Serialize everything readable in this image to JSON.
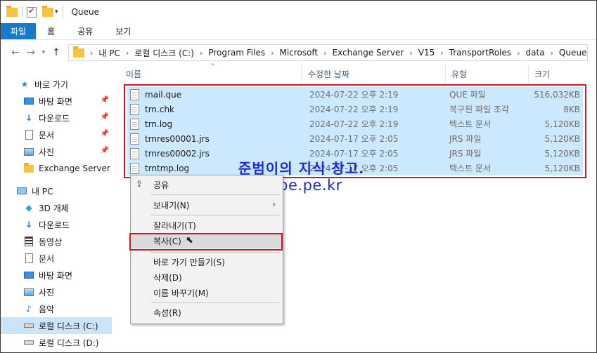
{
  "window": {
    "title": "Queue"
  },
  "ribbon": {
    "tabs": [
      "파일",
      "홈",
      "공유",
      "보기"
    ]
  },
  "address": {
    "crumbs": [
      "내 PC",
      "로컬 디스크 (C:)",
      "Program Files",
      "Microsoft",
      "Exchange Server",
      "V15",
      "TransportRoles",
      "data",
      "Queue"
    ]
  },
  "sidebar": {
    "items": [
      {
        "label": "바로 가기",
        "icon": "star-icon"
      },
      {
        "label": "바탕 화면",
        "icon": "desktop-icon"
      },
      {
        "label": "다운로드",
        "icon": "download-icon"
      },
      {
        "label": "문서",
        "icon": "document-icon"
      },
      {
        "label": "사진",
        "icon": "pictures-icon"
      },
      {
        "label": "Exchange Server",
        "icon": "folder-icon"
      },
      {
        "label": "내 PC",
        "icon": "pc-icon"
      },
      {
        "label": "3D 개체",
        "icon": "3d-objects-icon"
      },
      {
        "label": "다운로드",
        "icon": "download-icon"
      },
      {
        "label": "동영상",
        "icon": "video-icon"
      },
      {
        "label": "문서",
        "icon": "document-icon"
      },
      {
        "label": "바탕 화면",
        "icon": "desktop-icon"
      },
      {
        "label": "사진",
        "icon": "pictures-icon"
      },
      {
        "label": "음악",
        "icon": "music-icon"
      },
      {
        "label": "로컬 디스크 (C:)",
        "icon": "drive-icon"
      },
      {
        "label": "로컬 디스크 (D:)",
        "icon": "drive-icon"
      }
    ]
  },
  "columns": {
    "name": "이름",
    "date": "수정한 날짜",
    "type": "유형",
    "size": "크기"
  },
  "files": [
    {
      "name": "mail.que",
      "date": "2024-07-22 오후 2:19",
      "type": "QUE 파일",
      "size": "516,032KB"
    },
    {
      "name": "trn.chk",
      "date": "2024-07-22 오후 2:19",
      "type": "복구된 파일 조각",
      "size": "8KB"
    },
    {
      "name": "trn.log",
      "date": "2024-07-22 오후 2:19",
      "type": "텍스트 문서",
      "size": "5,120KB"
    },
    {
      "name": "trnres00001.jrs",
      "date": "2024-07-17 오후 2:05",
      "type": "JRS 파일",
      "size": "5,120KB"
    },
    {
      "name": "trnres00002.jrs",
      "date": "2024-07-17 오후 2:05",
      "type": "JRS 파일",
      "size": "5,120KB"
    },
    {
      "name": "trntmp.log",
      "date": "2024-07-17 오후 2:05",
      "type": "텍스트 문서",
      "size": "5,120KB"
    }
  ],
  "watermark": {
    "line1": "준범이의 지식 창고.",
    "line2": "hope.pe.kr"
  },
  "context_menu": {
    "share": "공유",
    "send_to": "보내기(N)",
    "cut": "잘라내기(T)",
    "copy": "복사(C)",
    "create_shortcut": "바로 가기 만들기(S)",
    "delete": "삭제(D)",
    "rename": "이름 바꾸기(M)",
    "properties": "속성(R)"
  },
  "colors": {
    "accent": "#1979ca",
    "selection": "#cce8ff",
    "highlight_box": "#d0182b",
    "watermark": "#1b2bd8"
  }
}
